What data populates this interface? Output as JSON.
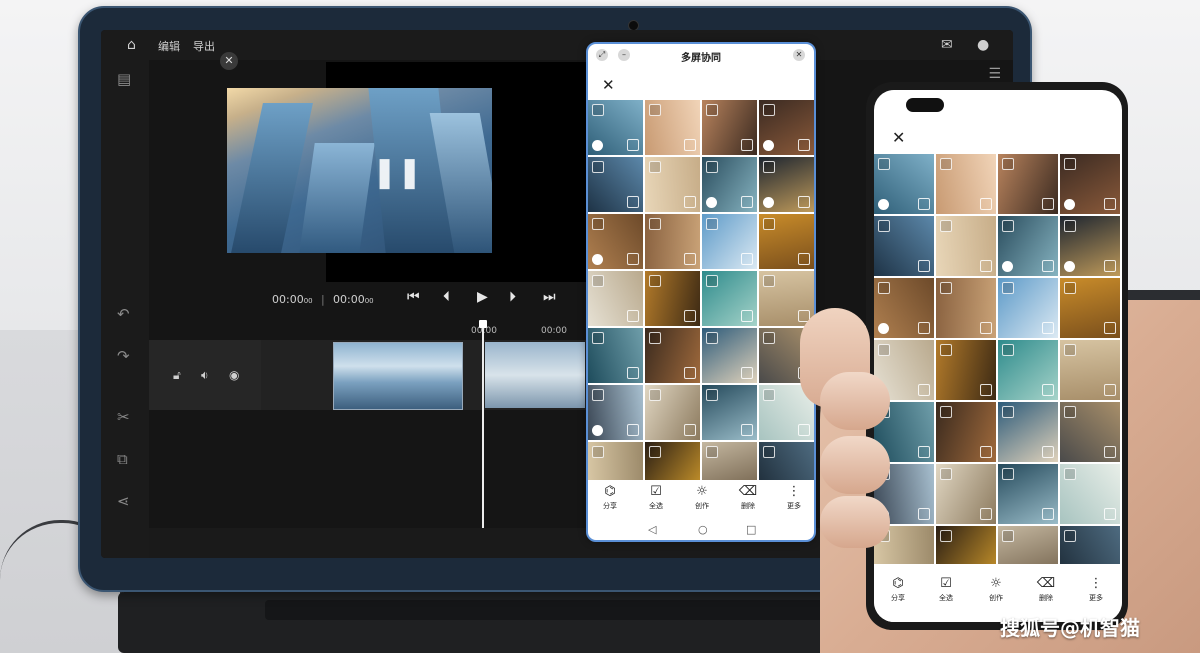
{
  "editor": {
    "menu_edit": "编辑",
    "menu_export": "导出",
    "time_current": "00:00",
    "time_current_sub": "00",
    "time_total": "00:00",
    "time_total_sub": "00",
    "ruler_label_1": "00:00",
    "ruler_label_2": "00:00"
  },
  "window": {
    "title": "多屏协同"
  },
  "actions": [
    {
      "label": "分享",
      "icon": "share-icon",
      "glyph": "⎔"
    },
    {
      "label": "全选",
      "icon": "select-all-icon",
      "glyph": "☑"
    },
    {
      "label": "创作",
      "icon": "create-icon",
      "glyph": "✦"
    },
    {
      "label": "删除",
      "icon": "delete-icon",
      "glyph": "🗑"
    },
    {
      "label": "更多",
      "icon": "more-icon",
      "glyph": "⋮"
    }
  ],
  "nav": {
    "back": "◁",
    "home": "○",
    "recent": "□"
  },
  "watermark": "搜狐号@机智猫",
  "colors": {
    "accent": "#5a8fd6",
    "editor_bg": "#151515"
  }
}
